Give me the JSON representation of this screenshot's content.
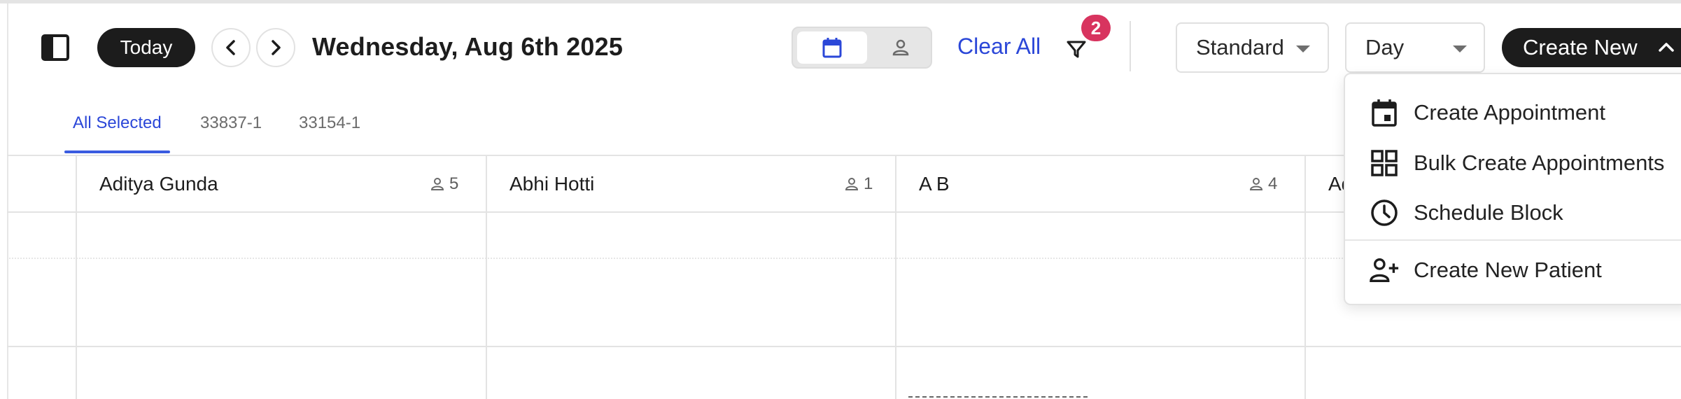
{
  "toolbar": {
    "today_label": "Today",
    "date_title": "Wednesday, Aug 6th 2025",
    "clear_all_label": "Clear All",
    "filter_badge_count": "2",
    "view_select": "Standard",
    "range_select": "Day",
    "create_label": "Create New"
  },
  "tabs": [
    {
      "label": "All Selected",
      "active": true
    },
    {
      "label": "33837-1",
      "active": false
    },
    {
      "label": "33154-1",
      "active": false
    }
  ],
  "columns": [
    {
      "name": "Aditya Gunda",
      "count": "5"
    },
    {
      "name": "Abhi Hotti",
      "count": "1"
    },
    {
      "name": "A B",
      "count": "4"
    },
    {
      "name": "Ad",
      "count": ""
    }
  ],
  "create_menu": {
    "items": [
      {
        "label": "Create Appointment",
        "icon": "calendar-icon"
      },
      {
        "label": "Bulk Create Appointments",
        "icon": "grid-icon"
      },
      {
        "label": "Schedule Block",
        "icon": "clock-icon"
      },
      {
        "label": "Create New Patient",
        "icon": "person-add-icon"
      }
    ]
  },
  "colors": {
    "accent_blue": "#2b47d8",
    "badge_pink": "#d8345f",
    "dark_button": "#1c1c1c"
  }
}
